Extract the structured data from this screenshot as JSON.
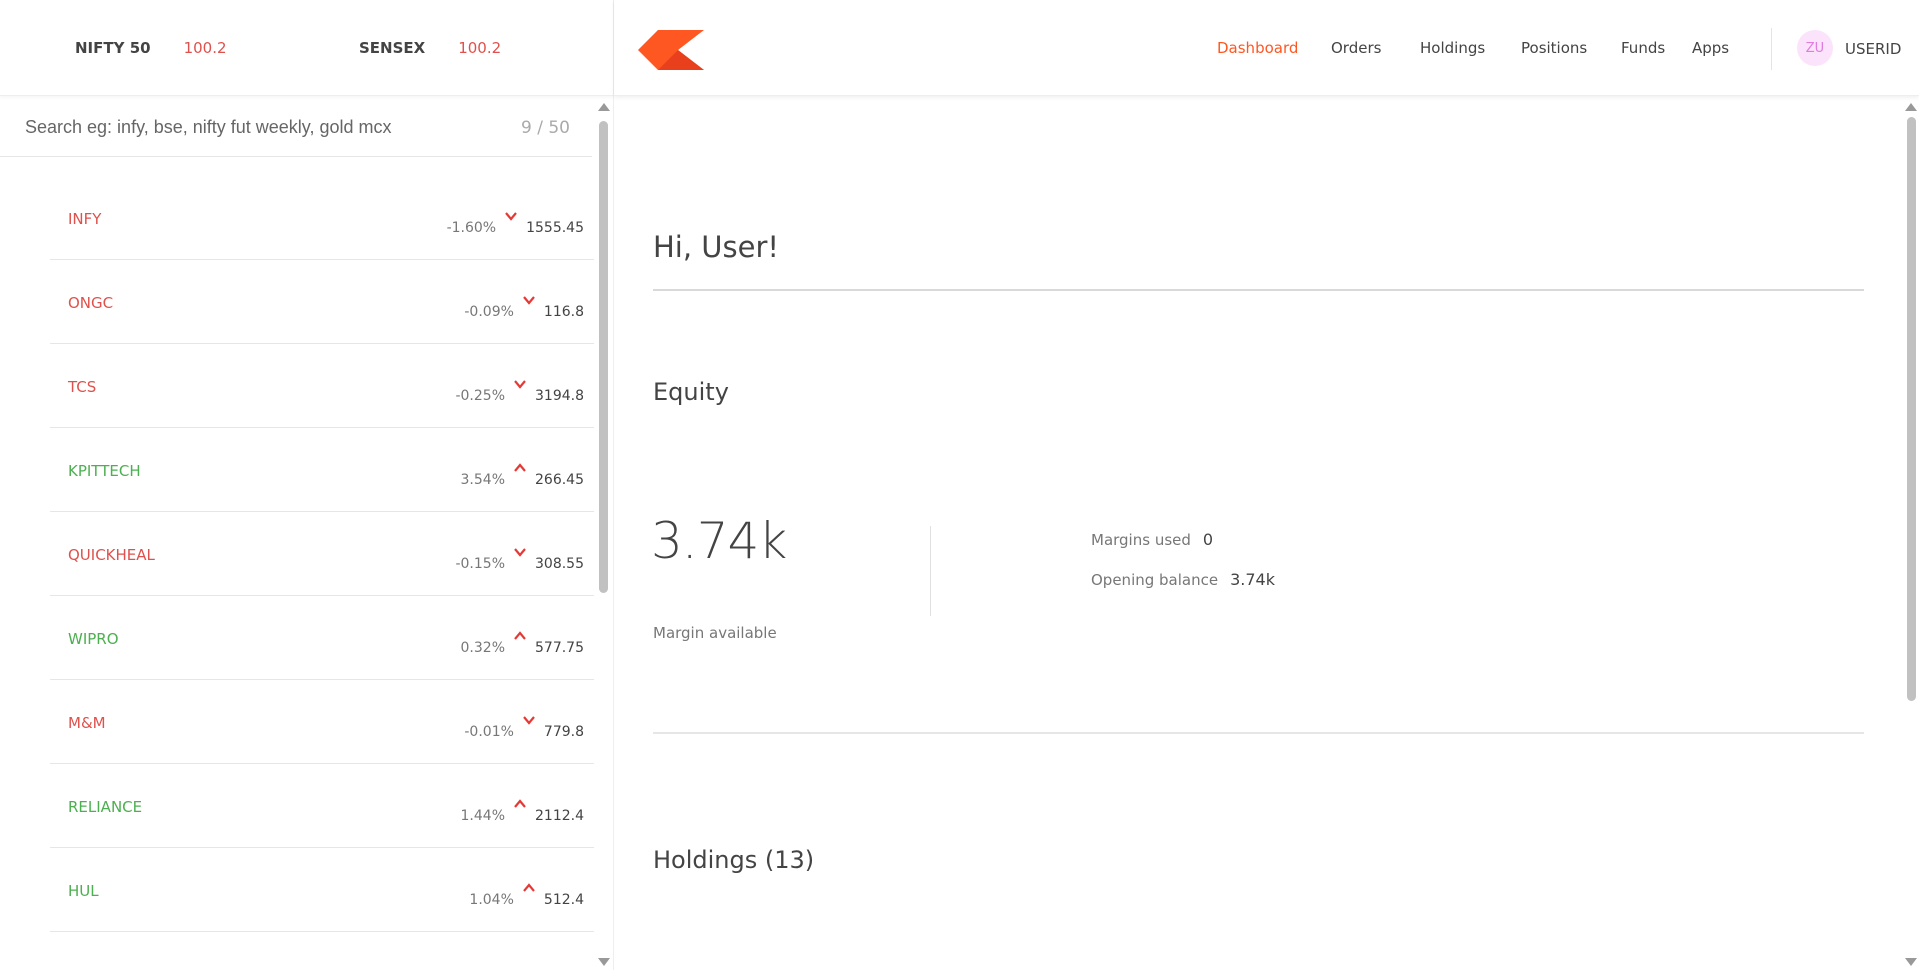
{
  "indices": {
    "nifty": {
      "name": "NIFTY 50",
      "value": "100.2"
    },
    "sensex": {
      "name": "SENSEX",
      "value": "100.2"
    }
  },
  "search": {
    "placeholder": "Search eg: infy, bse, nifty fut weekly, gold mcx",
    "count": "9 / 50"
  },
  "watchlist": [
    {
      "symbol": "INFY",
      "change": "-1.60%",
      "direction": "down",
      "price": "1555.45"
    },
    {
      "symbol": "ONGC",
      "change": "-0.09%",
      "direction": "down",
      "price": "116.8"
    },
    {
      "symbol": "TCS",
      "change": "-0.25%",
      "direction": "down",
      "price": "3194.8"
    },
    {
      "symbol": "KPITTECH",
      "change": "3.54%",
      "direction": "up",
      "price": "266.45"
    },
    {
      "symbol": "QUICKHEAL",
      "change": "-0.15%",
      "direction": "down",
      "price": "308.55"
    },
    {
      "symbol": "WIPRO",
      "change": "0.32%",
      "direction": "up",
      "price": "577.75"
    },
    {
      "symbol": "M&M",
      "change": "-0.01%",
      "direction": "down",
      "price": "779.8"
    },
    {
      "symbol": "RELIANCE",
      "change": "1.44%",
      "direction": "up",
      "price": "2112.4"
    },
    {
      "symbol": "HUL",
      "change": "1.04%",
      "direction": "up",
      "price": "512.4"
    }
  ],
  "nav": {
    "dashboard": "Dashboard",
    "orders": "Orders",
    "holdings": "Holdings",
    "positions": "Positions",
    "funds": "Funds",
    "apps": "Apps",
    "active": "dashboard"
  },
  "user": {
    "initials": "ZU",
    "id": "USERID"
  },
  "main": {
    "greeting": "Hi, User!",
    "equity_title": "Equity",
    "margin_available_value": "3.74k",
    "margin_available_label": "Margin available",
    "margins_used_label": "Margins used",
    "margins_used_value": "0",
    "opening_balance_label": "Opening balance",
    "opening_balance_value": "3.74k",
    "holdings_title": "Holdings (13)"
  },
  "colors": {
    "accent": "#ff5722",
    "down": "#df514c",
    "up": "#4caf50",
    "arrow": "#e53935"
  },
  "icons": {
    "logo": "kite-logo-icon",
    "down_arrow": "chevron-down-icon",
    "up_arrow": "chevron-up-icon"
  }
}
